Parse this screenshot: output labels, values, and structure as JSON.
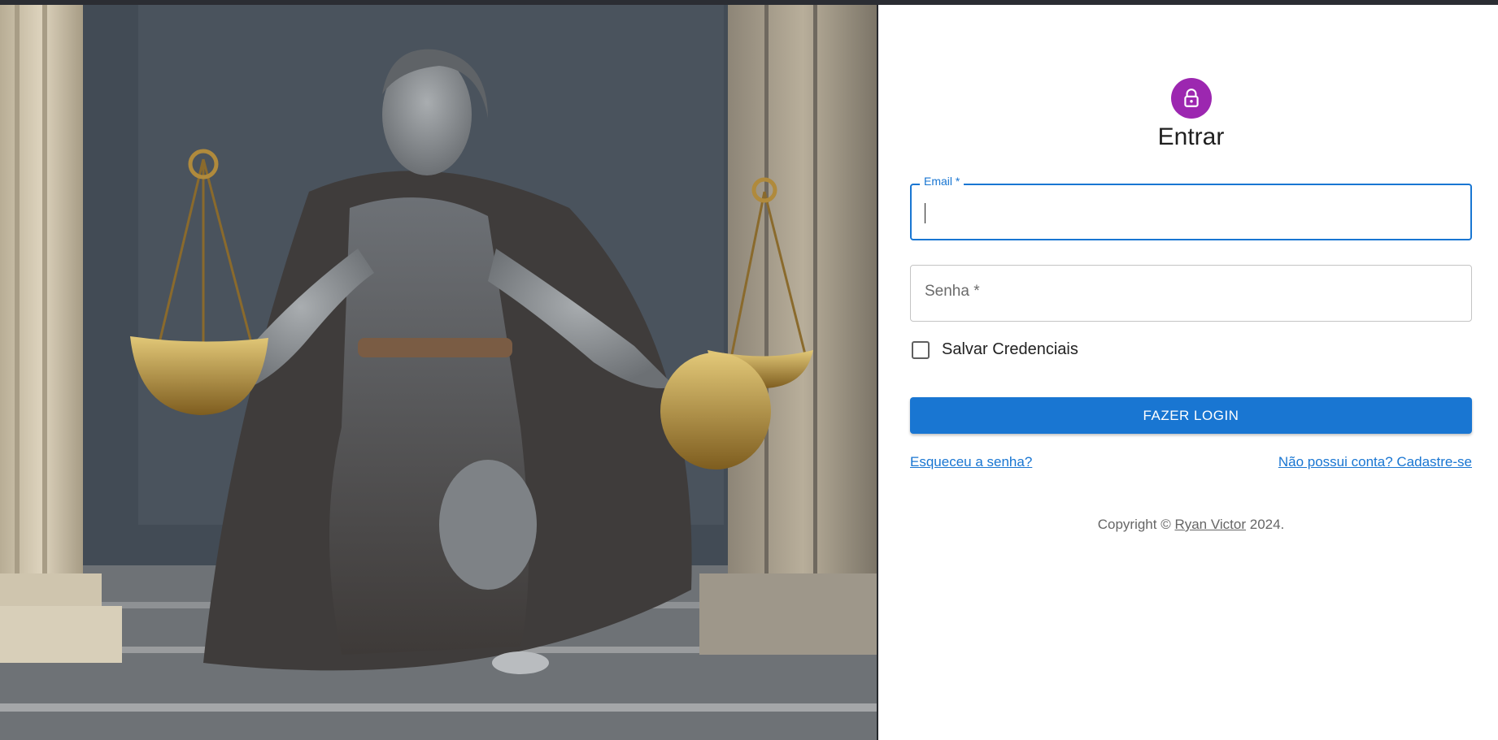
{
  "colors": {
    "primary": "#1976d2",
    "avatar": "#9c27b0",
    "topbar": "#2b2d33"
  },
  "hero": {
    "image": "statue-of-lady-justice-with-scales",
    "icon": "lady-justice-statue"
  },
  "form": {
    "avatar_icon": "lock-icon",
    "title": "Entrar",
    "email": {
      "label": "Email *",
      "value": ""
    },
    "password": {
      "label": "Senha *",
      "value": ""
    },
    "remember": {
      "label": "Salvar Credenciais",
      "checked": false
    },
    "submit_label": "FAZER LOGIN",
    "forgot_link": "Esqueceu a senha?",
    "signup_link": "Não possui conta? Cadastre-se"
  },
  "footer": {
    "prefix": "Copyright © ",
    "author": "Ryan Victor",
    "suffix": " 2024."
  }
}
